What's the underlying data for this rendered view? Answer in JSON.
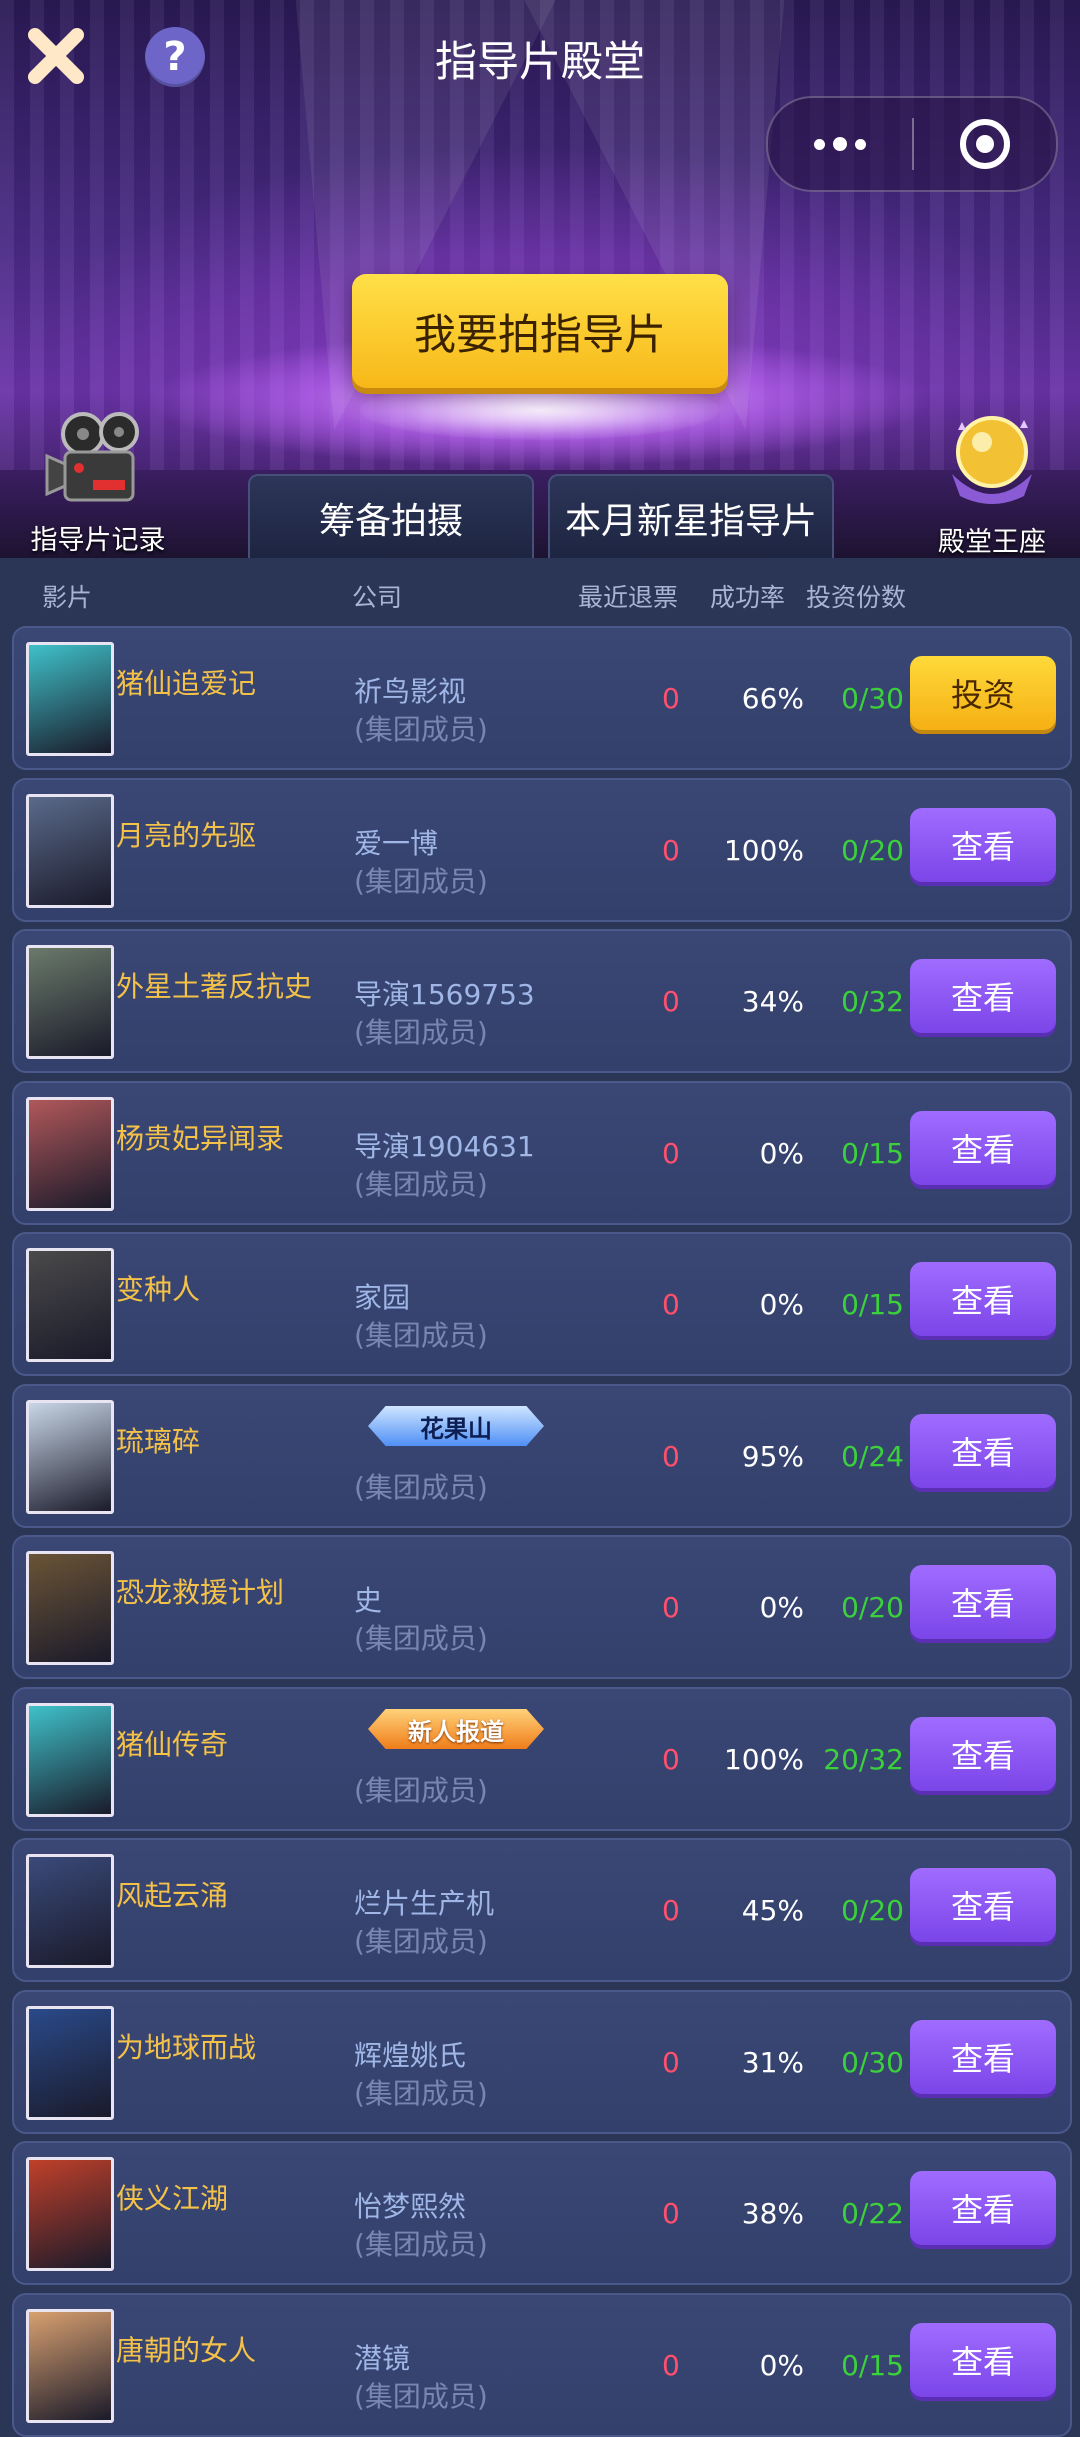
{
  "header": {
    "title": "指导片殿堂",
    "shoot_button": "我要拍指导片",
    "record_label": "指导片记录",
    "throne_label": "殿堂王座",
    "tabs": [
      {
        "label": "筹备拍摄"
      },
      {
        "label": "本月新星指导片"
      }
    ]
  },
  "columns": {
    "film": "影片",
    "company": "公司",
    "recent_refund": "最近退票",
    "success_rate": "成功率",
    "invest_shares": "投资份数"
  },
  "colors": {
    "accent_gold": "#f7b818",
    "accent_purple": "#8e56f5",
    "title_gold": "#f4c249",
    "refund_red": "#ff4f6c",
    "shares_green": "#3bd13b",
    "row_bg": "#36426e"
  },
  "rows": [
    {
      "title": "猪仙追爱记",
      "company": "祈鸟影视",
      "member": "(集团成员)",
      "refund": "0",
      "rate": "66%",
      "shares": "0/30",
      "button": "投资",
      "button_type": "invest",
      "poster_color": "#3fc1c9"
    },
    {
      "title": "月亮的先驱",
      "company": "爱一博",
      "member": "(集团成员)",
      "refund": "0",
      "rate": "100%",
      "shares": "0/20",
      "button": "查看",
      "button_type": "view",
      "poster_color": "#5a6a8a"
    },
    {
      "title": "外星土著反抗史",
      "company": "导演1569753",
      "member": "(集团成员)",
      "refund": "0",
      "rate": "34%",
      "shares": "0/32",
      "button": "查看",
      "button_type": "view",
      "poster_color": "#6a7a6a"
    },
    {
      "title": "杨贵妃异闻录",
      "company": "导演1904631",
      "member": "(集团成员)",
      "refund": "0",
      "rate": "0%",
      "shares": "0/15",
      "button": "查看",
      "button_type": "view",
      "poster_color": "#b0585a"
    },
    {
      "title": "变种人",
      "company": "家园",
      "member": "(集团成员)",
      "refund": "0",
      "rate": "0%",
      "shares": "0/15",
      "button": "查看",
      "button_type": "view",
      "poster_color": "#4a4a4a"
    },
    {
      "title": "琉璃碎",
      "company": "",
      "badge": "花果山",
      "badge_style": "blue",
      "member": "(集团成员)",
      "refund": "0",
      "rate": "95%",
      "shares": "0/24",
      "button": "查看",
      "button_type": "view",
      "poster_color": "#c8d6e6"
    },
    {
      "title": "恐龙救援计划",
      "company": "史",
      "member": "(集团成员)",
      "refund": "0",
      "rate": "0%",
      "shares": "0/20",
      "button": "查看",
      "button_type": "view",
      "poster_color": "#6b5436"
    },
    {
      "title": "猪仙传奇",
      "company": "",
      "badge": "新人报道",
      "badge_style": "orange",
      "member": "(集团成员)",
      "refund": "0",
      "rate": "100%",
      "shares": "20/32",
      "button": "查看",
      "button_type": "view",
      "poster_color": "#3fc1c9"
    },
    {
      "title": "风起云涌",
      "company": "烂片生产机",
      "member": "(集团成员)",
      "refund": "0",
      "rate": "45%",
      "shares": "0/20",
      "button": "查看",
      "button_type": "view",
      "poster_color": "#3a4a7a"
    },
    {
      "title": "为地球而战",
      "company": "辉煌姚氏",
      "member": "(集团成员)",
      "refund": "0",
      "rate": "31%",
      "shares": "0/30",
      "button": "查看",
      "button_type": "view",
      "poster_color": "#2a4a8a"
    },
    {
      "title": "侠义江湖",
      "company": "怡梦熙然",
      "member": "(集团成员)",
      "refund": "0",
      "rate": "38%",
      "shares": "0/22",
      "button": "查看",
      "button_type": "view",
      "poster_color": "#c0402a"
    },
    {
      "title": "唐朝的女人",
      "company": "潜镜",
      "member": "(集团成员)",
      "refund": "0",
      "rate": "0%",
      "shares": "0/15",
      "button": "查看",
      "button_type": "view",
      "poster_color": "#d8a070"
    }
  ]
}
